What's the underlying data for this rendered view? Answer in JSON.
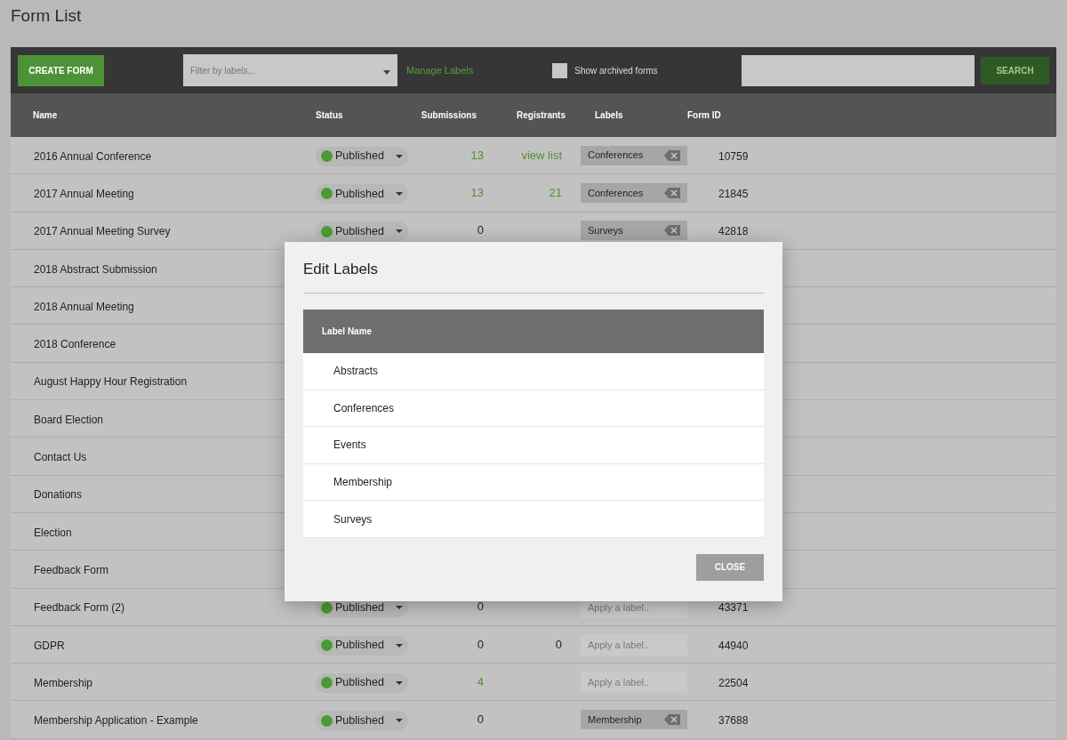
{
  "page": {
    "title": "Form List"
  },
  "toolbar": {
    "create_button": "CREATE FORM",
    "filter": {
      "placeholder": "Filter by labels..."
    },
    "manage_link": "Manage Labels",
    "archived": {
      "label": "Show archived forms",
      "checked": false
    },
    "search": {
      "button": "SEARCH"
    }
  },
  "table": {
    "columns": [
      "Name",
      "Status",
      "Submissions",
      "Registrants",
      "Labels",
      "Form ID"
    ],
    "rows": [
      {
        "name": "2016 Annual Conference",
        "status": "Published",
        "submissions": {
          "text": "13",
          "link": true
        },
        "registrants": {
          "text": "view list",
          "link": true
        },
        "label": {
          "kind": "tag",
          "text": "Conferences"
        },
        "form_id": "10759"
      },
      {
        "name": "2017 Annual Meeting",
        "status": "Published",
        "submissions": {
          "text": "13",
          "link": true
        },
        "registrants": {
          "text": "21",
          "link": true
        },
        "label": {
          "kind": "tag",
          "text": "Conferences"
        },
        "form_id": "21845"
      },
      {
        "name": "2017 Annual Meeting Survey",
        "status": "Published",
        "submissions": {
          "text": "0",
          "link": false
        },
        "label": {
          "kind": "tag",
          "text": "Surveys"
        },
        "form_id": "42818"
      },
      {
        "name": "2018 Abstract Submission"
      },
      {
        "name": "2018 Annual Meeting"
      },
      {
        "name": "2018 Conference"
      },
      {
        "name": "August Happy Hour Registration"
      },
      {
        "name": "Board Election"
      },
      {
        "name": "Contact Us"
      },
      {
        "name": "Donations"
      },
      {
        "name": "Election"
      },
      {
        "name": "Feedback Form"
      },
      {
        "name": "Feedback Form (2)",
        "status": "Published",
        "submissions": {
          "text": "0",
          "link": false
        },
        "label": {
          "kind": "input",
          "placeholder": "Apply a label.."
        },
        "form_id": "43371"
      },
      {
        "name": "GDPR",
        "status": "Published",
        "submissions": {
          "text": "0",
          "link": false
        },
        "registrants": {
          "text": "0",
          "link": false
        },
        "label": {
          "kind": "input",
          "placeholder": "Apply a label.."
        },
        "form_id": "44940"
      },
      {
        "name": "Membership",
        "status": "Published",
        "submissions": {
          "text": "4",
          "link": true
        },
        "label": {
          "kind": "input",
          "placeholder": "Apply a label.."
        },
        "form_id": "22504"
      },
      {
        "name": "Membership Application - Example",
        "status": "Published",
        "submissions": {
          "text": "0",
          "link": false
        },
        "label": {
          "kind": "tag",
          "text": "Membership"
        },
        "form_id": "37688"
      }
    ]
  },
  "dialog": {
    "title": "Edit Labels",
    "column": "Label Name",
    "labels": [
      "Abstracts",
      "Conferences",
      "Events",
      "Membership",
      "Surveys"
    ],
    "close_button": "CLOSE"
  }
}
